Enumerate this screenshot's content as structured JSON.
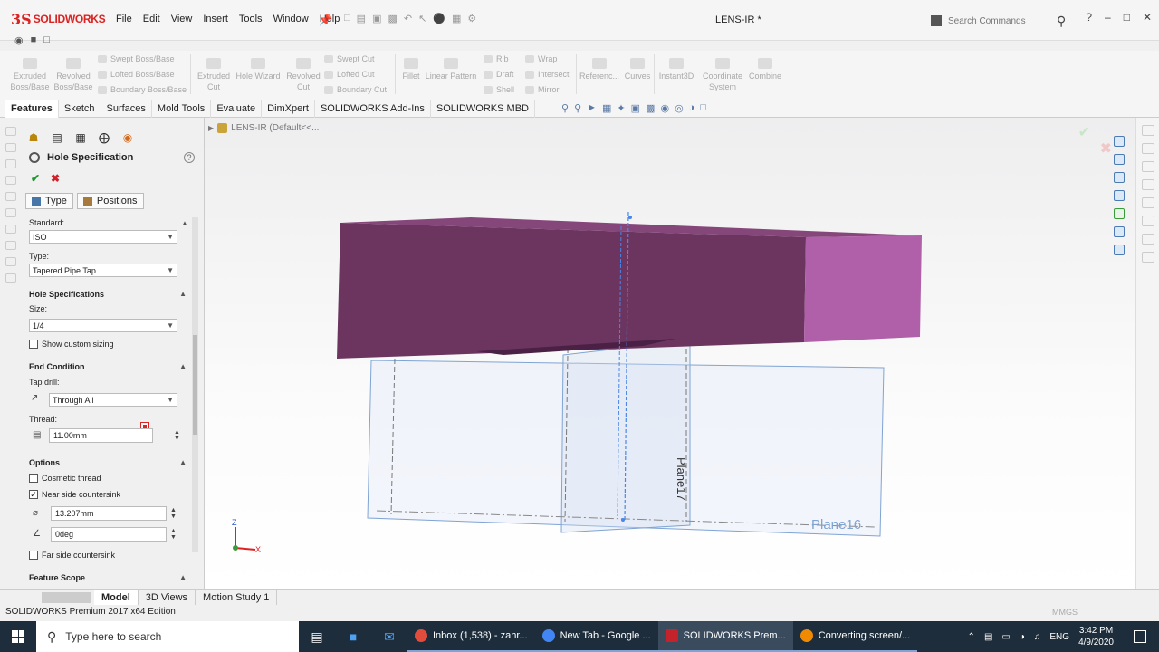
{
  "app": {
    "logo_text": "SOLIDWORKS",
    "menu": [
      "File",
      "Edit",
      "View",
      "Insert",
      "Tools",
      "Window",
      "Help"
    ],
    "document_title": "LENS-IR *",
    "search_placeholder": "Search Commands"
  },
  "command_manager": {
    "big_buttons": [
      {
        "label": "Extruded Boss/Base"
      },
      {
        "label": "Revolved Boss/Base"
      },
      {
        "label": "Extruded Cut"
      },
      {
        "label": "Hole Wizard"
      },
      {
        "label": "Revolved Cut"
      },
      {
        "label": "Fillet"
      },
      {
        "label": "Linear Pattern"
      },
      {
        "label": "Referenc..."
      },
      {
        "label": "Curves"
      },
      {
        "label": "Instant3D"
      },
      {
        "label": "Coordinate System"
      },
      {
        "label": "Combine"
      }
    ],
    "small_col1": [
      "Swept Boss/Base",
      "Lofted Boss/Base",
      "Boundary Boss/Base"
    ],
    "small_col2": [
      "Swept Cut",
      "Lofted Cut",
      "Boundary Cut"
    ],
    "small_col3": [
      "Rib",
      "Draft",
      "Shell"
    ],
    "small_col4": [
      "Wrap",
      "Intersect",
      "Mirror"
    ]
  },
  "tabs": [
    "Features",
    "Sketch",
    "Surfaces",
    "Mold Tools",
    "Evaluate",
    "DimXpert",
    "SOLIDWORKS Add-Ins",
    "SOLIDWORKS MBD"
  ],
  "property_manager": {
    "title": "Hole Specification",
    "subtabs": [
      "Type",
      "Positions"
    ],
    "standard_label": "Standard:",
    "standard_value": "ISO",
    "type_label": "Type:",
    "type_value": "Tapered Pipe Tap",
    "hole_spec_header": "Hole Specifications",
    "size_label": "Size:",
    "size_value": "1/4",
    "show_custom_sizing": "Show custom sizing",
    "end_condition_header": "End Condition",
    "tap_drill_label": "Tap drill:",
    "tap_drill_value": "Through All",
    "thread_label": "Thread:",
    "thread_value": "11.00mm",
    "options_header": "Options",
    "cosmetic_thread": "Cosmetic thread",
    "near_side_countersink": "Near side countersink",
    "near_side_checked": true,
    "countersink_dia": "13.207mm",
    "countersink_angle": "0deg",
    "far_side_countersink": "Far side countersink",
    "feature_scope_header": "Feature Scope"
  },
  "graphics": {
    "tree_label": "LENS-IR  (Default<<...",
    "plane_label_1": "Plane16",
    "plane_label_2": "Plane17",
    "triad_z": "Z",
    "triad_x": "X",
    "body_front_color": "#6b3560",
    "body_top_color": "#85477a",
    "body_side_color": "#b060a8",
    "plane_color": "#7fa4d4"
  },
  "bottom_tabs": [
    "Model",
    "3D Views",
    "Motion Study 1"
  ],
  "status": {
    "left": "SOLIDWORKS Premium 2017 x64 Edition",
    "units": "MMGS"
  },
  "taskbar": {
    "search_placeholder": "Type here to search",
    "apps": [
      {
        "label": "Inbox (1,538) - zahr...",
        "color": "#e24c3c"
      },
      {
        "label": "New Tab - Google ...",
        "color": "#4285f4"
      },
      {
        "label": "SOLIDWORKS Prem...",
        "color": "#c4232b"
      },
      {
        "label": "Converting screen/...",
        "color": "#f18a00"
      }
    ],
    "lang": "ENG",
    "time": "3:42 PM",
    "date": "4/9/2020"
  }
}
